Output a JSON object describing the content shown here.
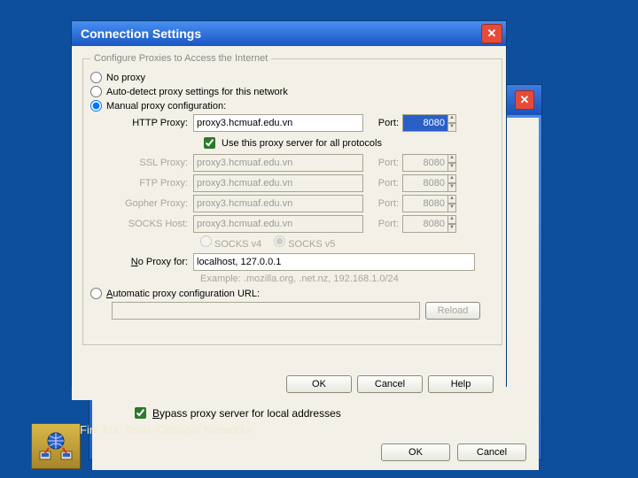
{
  "conn": {
    "title": "Connection Settings",
    "group_legend": "Configure Proxies to Access the Internet",
    "radios": {
      "no_proxy": "No proxy",
      "auto_detect": "Auto-detect proxy settings for this network",
      "manual": "Manual proxy configuration:",
      "auto_url": "Automatic proxy configuration URL:"
    },
    "labels": {
      "http": "HTTP Proxy:",
      "ssl": "SSL Proxy:",
      "ftp": "FTP Proxy:",
      "gopher": "Gopher Proxy:",
      "socks": "SOCKS Host:",
      "port": "Port:",
      "noproxy": "No Proxy for:",
      "use_all": "Use this proxy server for all protocols",
      "socks_v4": "SOCKS v4",
      "socks_v5": "SOCKS v5",
      "example": "Example: .mozilla.org, .net.nz, 192.168.1.0/24",
      "reload": "Reload"
    },
    "values": {
      "http_host": "proxy3.hcmuaf.edu.vn",
      "http_port": "8080",
      "ssl_host": "proxy3.hcmuaf.edu.vn",
      "ssl_port": "8080",
      "ftp_host": "proxy3.hcmuaf.edu.vn",
      "ftp_port": "8080",
      "gopher_host": "proxy3.hcmuaf.edu.vn",
      "gopher_port": "8080",
      "socks_host": "proxy3.hcmuaf.edu.vn",
      "socks_port": "8080",
      "noproxy": "localhost, 127.0.0.1",
      "auto_url": ""
    },
    "buttons": {
      "ok": "OK",
      "cancel": "Cancel",
      "help": "Help"
    }
  },
  "lan": {
    "title": "",
    "bypass": "Bypass proxy server for local addresses",
    "ok": "OK",
    "cancel": "Cancel"
  },
  "caption": "Fire fox: Tools /Options/ Networks"
}
